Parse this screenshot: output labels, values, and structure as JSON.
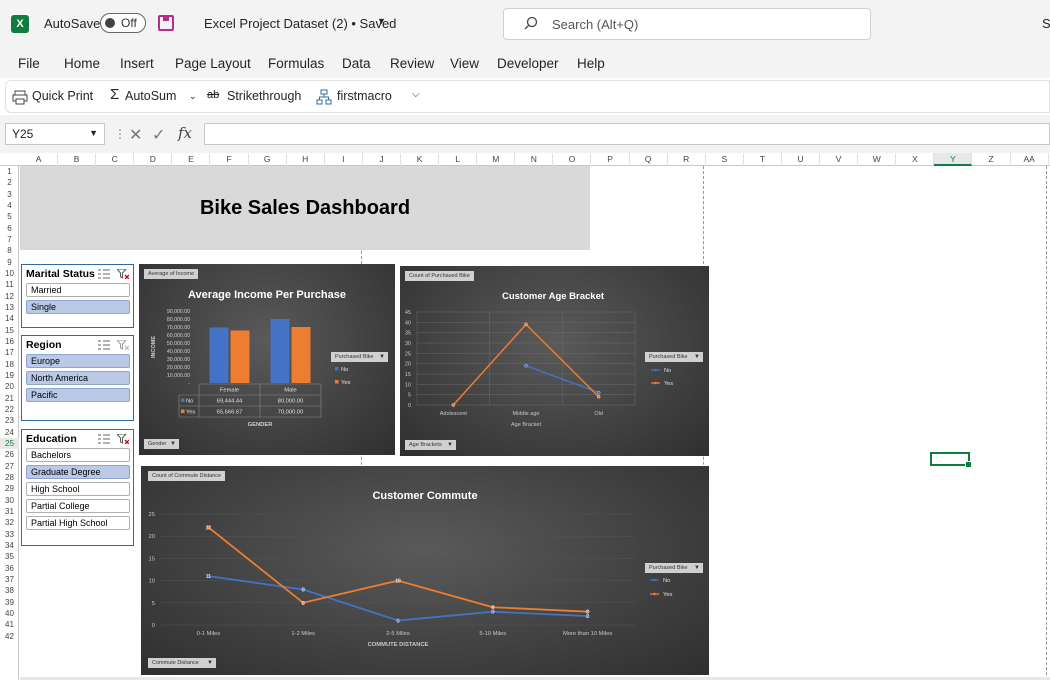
{
  "app": {
    "autosave_label": "AutoSave",
    "autosave_state": "Off",
    "doc_title": "Excel Project Dataset (2) • Saved",
    "search_placeholder": "Search (Alt+Q)",
    "user_initial": "S",
    "logo_letter": "X"
  },
  "menu": [
    "File",
    "Home",
    "Insert",
    "Page Layout",
    "Formulas",
    "Data",
    "Review",
    "View",
    "Developer",
    "Help"
  ],
  "qat": [
    "Quick Print",
    "AutoSum",
    "Strikethrough",
    "firstmacro"
  ],
  "formula_bar": {
    "name_box": "Y25",
    "formula": ""
  },
  "columns": [
    "A",
    "B",
    "C",
    "D",
    "E",
    "F",
    "G",
    "H",
    "I",
    "J",
    "K",
    "L",
    "M",
    "N",
    "O",
    "P",
    "Q",
    "R",
    "S",
    "T",
    "U",
    "V",
    "W",
    "X",
    "Y",
    "Z",
    "AA"
  ],
  "selected_column": "Y",
  "rows": [
    "1",
    "2",
    "3",
    "4",
    "5",
    "6",
    "7",
    "8",
    "9",
    "10",
    "11",
    "12",
    "13",
    "14",
    "15",
    "16",
    "17",
    "18",
    "19",
    "20",
    "21",
    "22",
    "23",
    "24",
    "25",
    "26",
    "27",
    "28",
    "29",
    "30",
    "31",
    "32",
    "33",
    "34",
    "35",
    "36",
    "37",
    "38",
    "39",
    "40",
    "41",
    "42"
  ],
  "selected_row": "25",
  "dashboard": {
    "title": "Bike Sales Dashboard",
    "slicers": [
      {
        "title": "Marital Status",
        "items": [
          {
            "label": "Married",
            "selected": false
          },
          {
            "label": "Single",
            "selected": true
          }
        ]
      },
      {
        "title": "Region",
        "items": [
          {
            "label": "Europe",
            "selected": true
          },
          {
            "label": "North America",
            "selected": true
          },
          {
            "label": "Pacific",
            "selected": true
          }
        ]
      },
      {
        "title": "Education",
        "items": [
          {
            "label": "Bachelors",
            "selected": false
          },
          {
            "label": "Graduate Degree",
            "selected": true
          },
          {
            "label": "High School",
            "selected": false
          },
          {
            "label": "Partial College",
            "selected": false
          },
          {
            "label": "Partial High School",
            "selected": false
          }
        ]
      }
    ]
  },
  "colors": {
    "no": "#4472c4",
    "yes": "#ed7d31",
    "excel_green": "#107c41"
  },
  "chart_data": [
    {
      "type": "bar",
      "title": "Average Income Per Purchase",
      "field_tag": "Average of Income",
      "axis_filter": "Gender",
      "legend_filter": "Purchased Bike",
      "xlabel": "GENDER",
      "ylabel": "INCOME",
      "ylim": [
        0,
        90000
      ],
      "yticks": [
        "90,000.00",
        "80,000.00",
        "70,000.00",
        "60,000.00",
        "50,000.00",
        "40,000.00",
        "30,000.00",
        "20,000.00",
        "10,000.00",
        "-"
      ],
      "categories": [
        "Female",
        "Male"
      ],
      "series": [
        {
          "name": "No",
          "values": [
            69444.44,
            80000.0
          ],
          "labels": [
            "69,444.44",
            "80,000.00"
          ]
        },
        {
          "name": "Yes",
          "values": [
            65666.67,
            70000.0
          ],
          "labels": [
            "65,666.67",
            "70,000.00"
          ]
        }
      ],
      "legend": "right"
    },
    {
      "type": "line",
      "title": "Customer Age Bracket",
      "field_tag": "Count of Purchased Bike",
      "axis_filter": "Age Brackets",
      "legend_filter": "Purchased Bike",
      "xlabel": "Age Bracket",
      "ylim": [
        0,
        45
      ],
      "yticks": [
        "45",
        "40",
        "35",
        "30",
        "25",
        "20",
        "15",
        "10",
        "5",
        "0"
      ],
      "categories": [
        "Adolescent",
        "Middle age",
        "Old"
      ],
      "series": [
        {
          "name": "No",
          "values": [
            null,
            19,
            6
          ]
        },
        {
          "name": "Yes",
          "values": [
            0,
            39,
            4
          ]
        }
      ],
      "legend": "right"
    },
    {
      "type": "line",
      "title": "Customer Commute",
      "field_tag": "Count of Commute Distance",
      "axis_filter": "Commute Distance",
      "legend_filter": "Purchased Bike",
      "xlabel": "COMMUTE DISTANCE",
      "ylim": [
        0,
        25
      ],
      "yticks": [
        "25",
        "20",
        "15",
        "10",
        "5",
        "0"
      ],
      "categories": [
        "0-1 Miles",
        "1-2 Miles",
        "2-5 Miles",
        "5-10 Miles",
        "More than 10 Miles"
      ],
      "series": [
        {
          "name": "No",
          "values": [
            11,
            8,
            1,
            3,
            2
          ],
          "labels": [
            "11",
            "8",
            "1",
            "3",
            "2"
          ]
        },
        {
          "name": "Yes",
          "values": [
            22,
            5,
            10,
            4,
            3
          ],
          "labels": [
            "22",
            "5",
            "10",
            "4",
            "3"
          ]
        }
      ],
      "legend": "right"
    }
  ]
}
